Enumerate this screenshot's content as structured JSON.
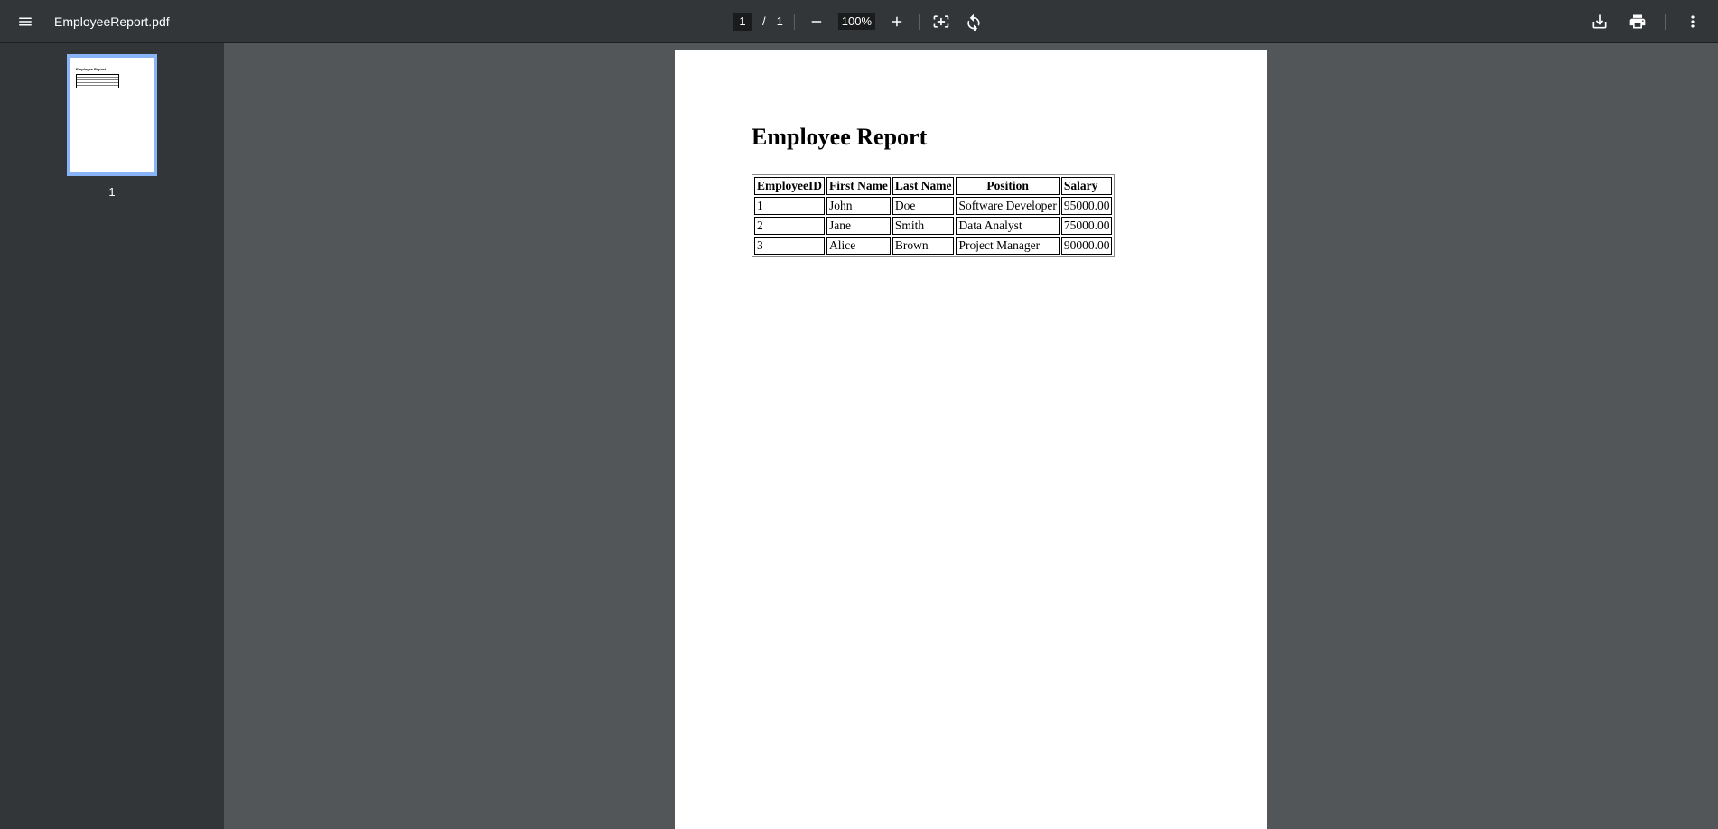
{
  "header": {
    "filename": "EmployeeReport.pdf",
    "current_page": "1",
    "page_separator": "/",
    "total_pages": "1",
    "zoom": "100%"
  },
  "sidebar": {
    "thumb_label": "1"
  },
  "document": {
    "title": "Employee Report",
    "columns": [
      "EmployeeID",
      "First Name",
      "Last Name",
      "Position",
      "Salary"
    ],
    "rows": [
      {
        "id": "1",
        "first": "John",
        "last": "Doe",
        "position": "Software Developer",
        "salary": "95000.00"
      },
      {
        "id": "2",
        "first": "Jane",
        "last": "Smith",
        "position": "Data Analyst",
        "salary": "75000.00"
      },
      {
        "id": "3",
        "first": "Alice",
        "last": "Brown",
        "position": "Project Manager",
        "salary": "90000.00"
      }
    ]
  }
}
